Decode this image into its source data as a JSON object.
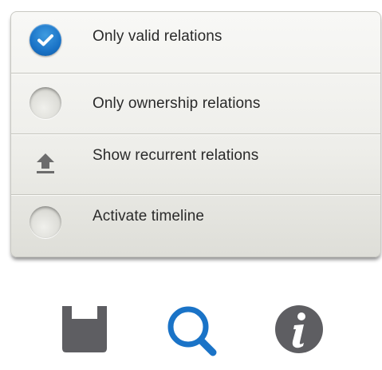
{
  "options": [
    {
      "label": "Only valid relations",
      "state": "checked",
      "icon": "checkmark-radio-icon"
    },
    {
      "label": "Only ownership relations",
      "state": "unchecked",
      "icon": "radio-icon"
    },
    {
      "label": "Show recurrent relations",
      "state": "action",
      "icon": "upload-arrow-icon"
    },
    {
      "label": "Activate timeline",
      "state": "unchecked",
      "icon": "radio-icon"
    }
  ],
  "toolbar": {
    "buttons": [
      {
        "icon": "save-icon"
      },
      {
        "icon": "search-icon"
      },
      {
        "icon": "info-icon"
      }
    ]
  },
  "colors": {
    "accent_blue": "#1a73c7",
    "icon_gray": "#5e5e62",
    "panel_bg": "#eeeeea",
    "text": "#2a2a2a"
  }
}
